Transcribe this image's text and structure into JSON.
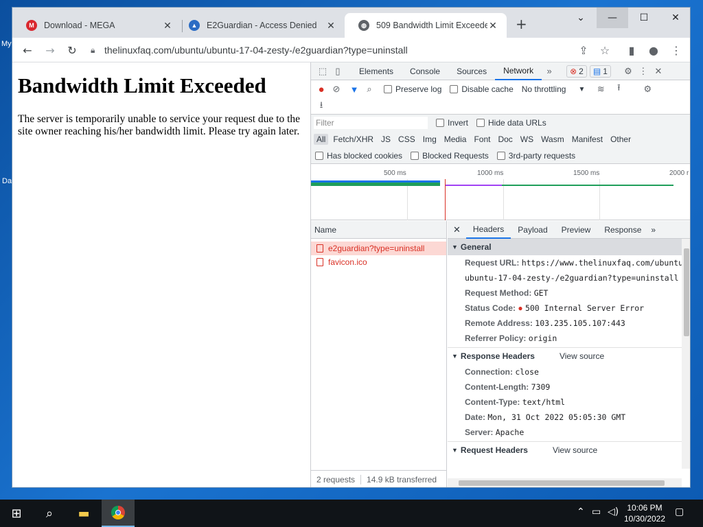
{
  "desktop": {
    "labels": [
      "My",
      "Da"
    ]
  },
  "browser": {
    "tabs": [
      {
        "title": "Download - MEGA",
        "icon": "mega-icon"
      },
      {
        "title": "E2Guardian - Access Denied",
        "icon": "e2guardian-icon"
      },
      {
        "title": "509 Bandwidth Limit Exceeded",
        "icon": "globe-icon"
      }
    ],
    "address": "thelinuxfaq.com/ubuntu/ubuntu-17-04-zesty-/e2guardian?type=uninstall"
  },
  "page": {
    "heading": "Bandwidth Limit Exceeded",
    "message": "The server is temporarily unable to service your request due to the site owner reaching his/her bandwidth limit. Please try again later."
  },
  "devtools": {
    "tabs": [
      "Elements",
      "Console",
      "Sources",
      "Network"
    ],
    "errors_count": "2",
    "messages_count": "1",
    "network_toolbar": {
      "preserve_log": "Preserve log",
      "disable_cache": "Disable cache",
      "throttling": "No throttling"
    },
    "filter": {
      "placeholder": "Filter",
      "invert": "Invert",
      "hide_data_urls": "Hide data URLs"
    },
    "types": [
      "All",
      "Fetch/XHR",
      "JS",
      "CSS",
      "Img",
      "Media",
      "Font",
      "Doc",
      "WS",
      "Wasm",
      "Manifest",
      "Other"
    ],
    "blocked": {
      "has_blocked_cookies": "Has blocked cookies",
      "blocked_requests": "Blocked Requests",
      "third_party": "3rd-party requests"
    },
    "timeline_ticks": [
      "500 ms",
      "1000 ms",
      "1500 ms",
      "2000 r"
    ],
    "requests_header": "Name",
    "requests": [
      "e2guardian?type=uninstall",
      "favicon.ico"
    ],
    "footer": {
      "count": "2 requests",
      "transferred": "14.9 kB transferred"
    },
    "detail_tabs": [
      "Headers",
      "Payload",
      "Preview",
      "Response"
    ],
    "general": {
      "title": "General",
      "request_url_label": "Request URL:",
      "request_url_1": "https://www.thelinuxfaq.com/ubuntu/",
      "request_url_2": "ubuntu-17-04-zesty-/e2guardian?type=uninstall",
      "request_method_label": "Request Method:",
      "request_method": "GET",
      "status_code_label": "Status Code:",
      "status_code": "500 Internal Server Error",
      "remote_address_label": "Remote Address:",
      "remote_address": "103.235.105.107:443",
      "referrer_policy_label": "Referrer Policy:",
      "referrer_policy": "origin"
    },
    "response_headers": {
      "title": "Response Headers",
      "view_source": "View source",
      "connection_label": "Connection:",
      "connection": "close",
      "content_length_label": "Content-Length:",
      "content_length": "7309",
      "content_type_label": "Content-Type:",
      "content_type": "text/html",
      "date_label": "Date:",
      "date": "Mon, 31 Oct 2022 05:05:30 GMT",
      "server_label": "Server:",
      "server": "Apache"
    },
    "request_headers": {
      "title": "Request Headers",
      "view_source": "View source"
    }
  },
  "taskbar": {
    "time": "10:06 PM",
    "date": "10/30/2022"
  },
  "colors": {
    "error_red": "#d93025",
    "accent_blue": "#1a73e8"
  }
}
